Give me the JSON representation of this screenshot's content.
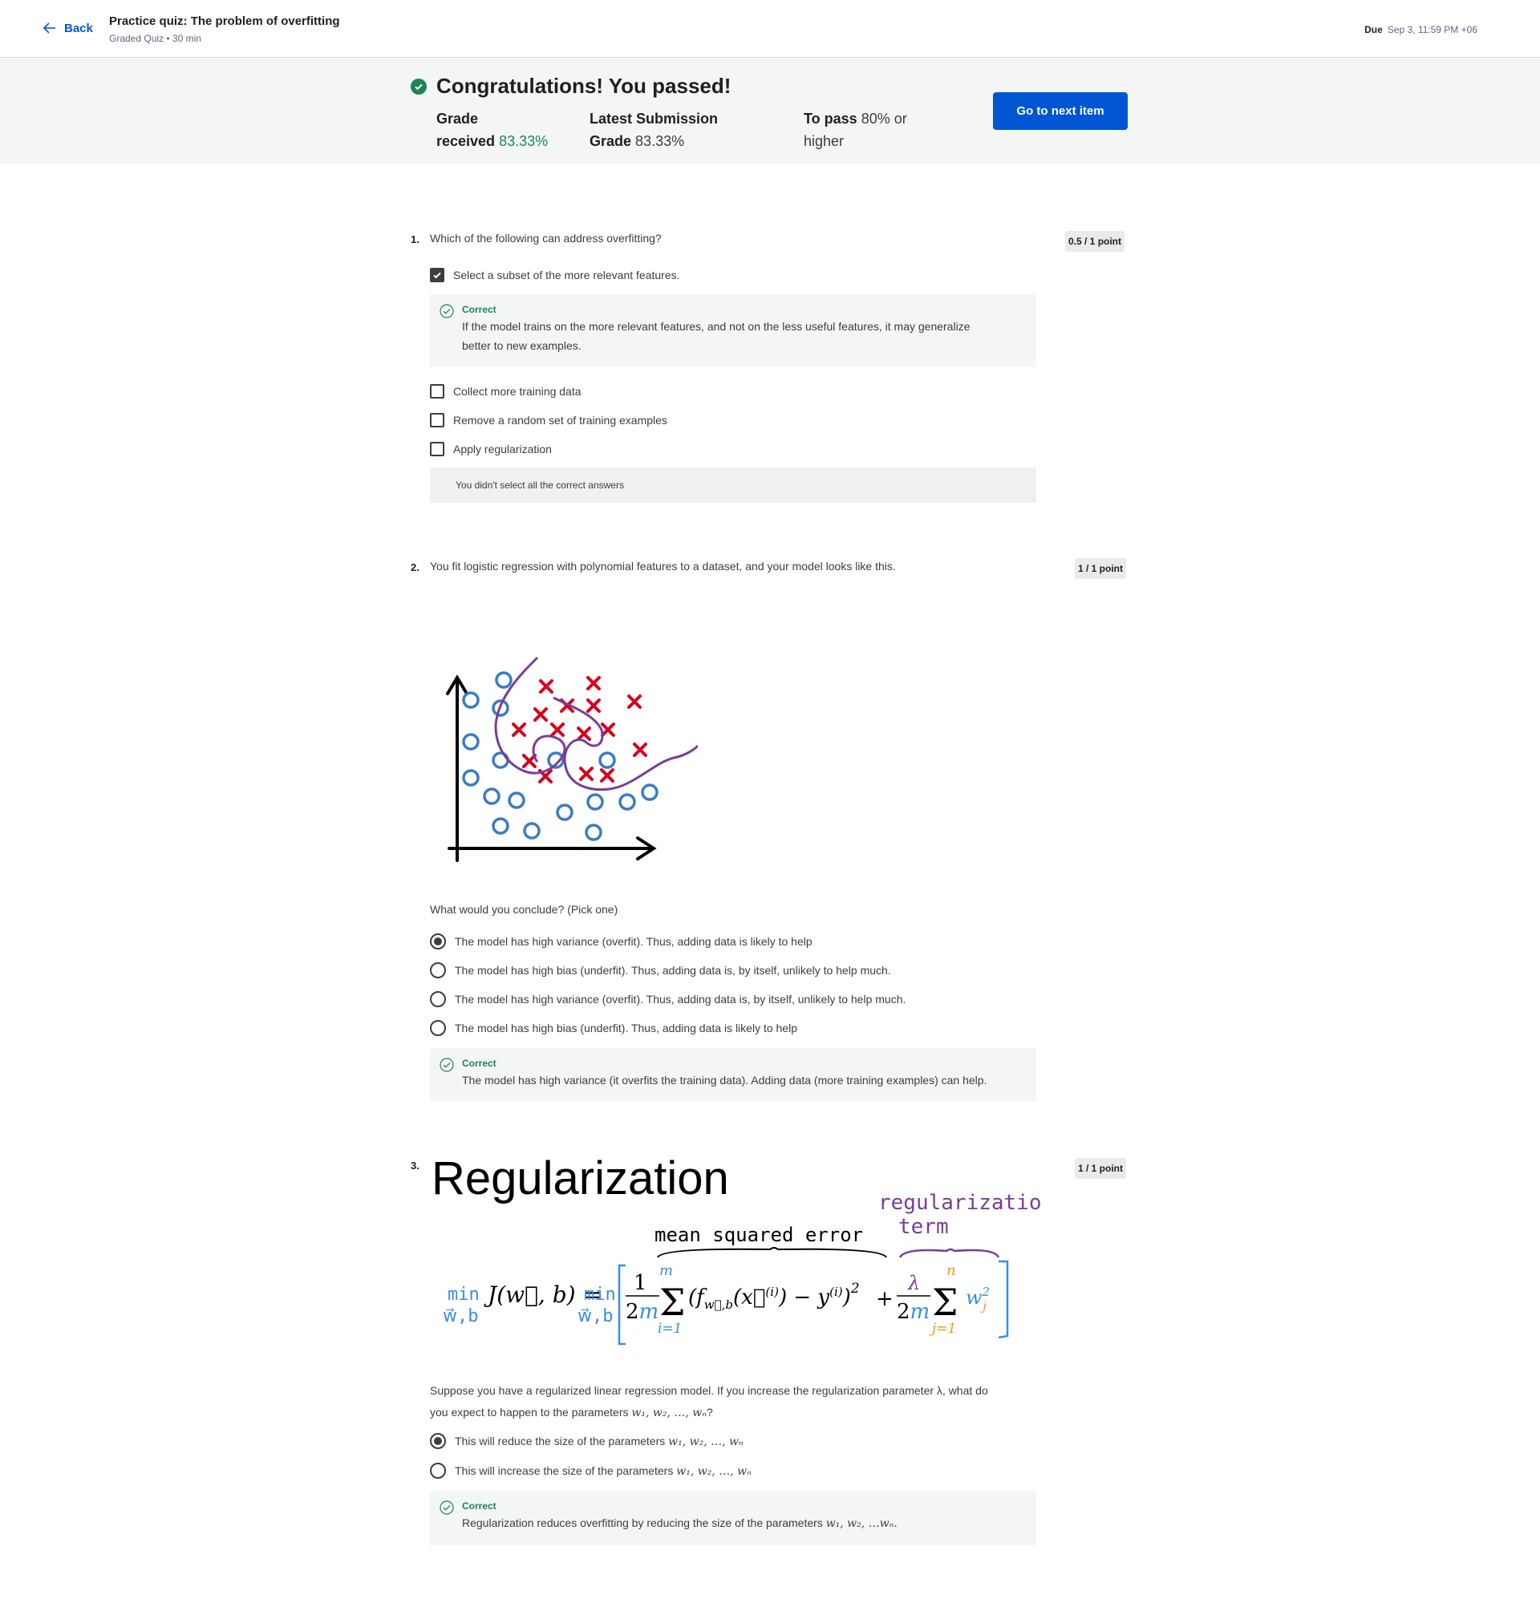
{
  "header": {
    "back_label": "Back",
    "title": "Practice quiz: The problem of overfitting",
    "subtitle": "Graded Quiz • 30 min",
    "due_label": "Due",
    "due_value": "Sep 3, 11:59 PM +06"
  },
  "result": {
    "heading": "Congratulations! You passed!",
    "grade_label_1": "Grade",
    "grade_label_2": "received",
    "grade_value": "83.33%",
    "latest_label_1": "Latest Submission",
    "latest_label_2": "Grade",
    "latest_value": "83.33%",
    "pass_label": "To pass",
    "pass_value_1": "80% or",
    "pass_value_2": "higher",
    "next_button": "Go to next item",
    "colors": {
      "primary": "#0056d2",
      "success": "#1f8354"
    }
  },
  "questions": [
    {
      "number": "1.",
      "text": "Which of the following can address overfitting?",
      "points": "0.5 / 1 point",
      "options": [
        {
          "label": "Select a subset of the more relevant features.",
          "checked": true
        },
        {
          "label": "Collect more training data",
          "checked": false
        },
        {
          "label": "Remove a random set of training examples",
          "checked": false
        },
        {
          "label": "Apply regularization",
          "checked": false
        }
      ],
      "feedback_label": "Correct",
      "feedback_line1": "If the model trains on the more relevant features, and not on the less useful features, it may generalize",
      "feedback_line2": "better to new examples.",
      "warning": "You didn't select all the correct answers"
    },
    {
      "number": "2.",
      "text": "You fit logistic regression with polynomial features to a dataset, and your model looks like this.",
      "points": "1 / 1 point",
      "prompt": "What would you conclude? (Pick one)",
      "options": [
        {
          "label": "The model has high variance (overfit). Thus, adding data is likely to help",
          "selected": true
        },
        {
          "label": "The model has high bias (underfit). Thus, adding data is, by itself, unlikely to help much.",
          "selected": false
        },
        {
          "label": "The model has high variance (overfit). Thus, adding data is, by itself, unlikely to help much.",
          "selected": false
        },
        {
          "label": "The model has high bias (underfit). Thus, adding data is likely to help",
          "selected": false
        }
      ],
      "feedback_label": "Correct",
      "feedback_text": "The model has high variance (it overfits the training data). Adding data (more training examples) can help."
    },
    {
      "number": "3.",
      "points": "1 / 1 point",
      "image_title": "Regularization",
      "ann_reg_1": "regularization",
      "ann_reg_2": "term",
      "ann_mse": "mean squared error",
      "ann_min": "min",
      "ann_wb": "w⃗,b",
      "q_line1": "Suppose you have a regularized linear regression model.  If you increase the regularization parameter λ, what do",
      "q_line2_pre": "you expect to happen to the parameters ",
      "params": "w₁, w₂, …, wₙ",
      "q_line2_post": "?",
      "options": [
        {
          "label": "This will reduce the size of the parameters ",
          "selected": true
        },
        {
          "label": "This will increase the size of the parameters ",
          "selected": false
        }
      ],
      "feedback_label": "Correct",
      "feedback_pre": "Regularization reduces overfitting by reducing the size of the parameters ",
      "feedback_params": "w₁, w₂, …wₙ."
    }
  ]
}
